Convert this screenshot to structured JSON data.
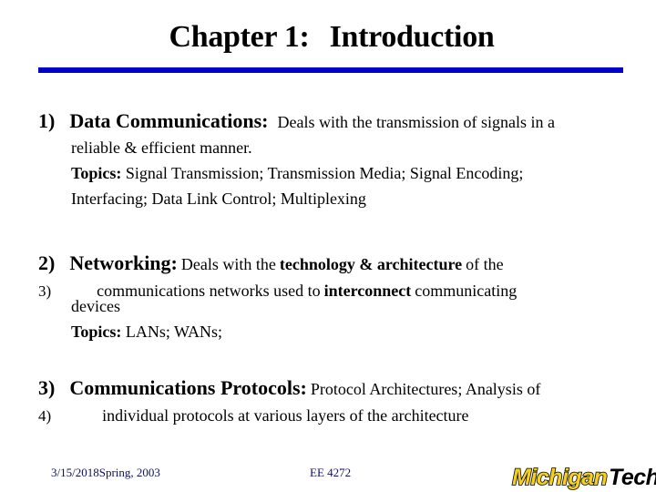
{
  "slide": {
    "title_part1": "Chapter 1:",
    "title_part2": "Introduction",
    "accent_color": "#0000cc"
  },
  "items": [
    {
      "number": "1)",
      "heading": "Data Communications:",
      "text1": "Deals with the transmission of signals in a",
      "text2": "reliable & efficient manner.",
      "topics_label": "Topics:",
      "topics_line1": "Signal Transmission; Transmission Media; Signal Encoding;",
      "topics_line2": "Interfacing; Data Link Control; Multiplexing"
    },
    {
      "number": "2)",
      "heading": "Networking:",
      "text_a": "Deals with the",
      "bold_a": "technology & architecture",
      "text_b": "of the",
      "sub_number": "3)",
      "text_c": "communications networks used to",
      "bold_b": "interconnect",
      "text_d": "communicating",
      "text_e": "devices",
      "topics_label": "Topics:",
      "topics_line1": "LANs; WANs;"
    },
    {
      "number": "3)",
      "heading": "Communications Protocols:",
      "text1": "Protocol Architectures; Analysis of",
      "sub_number": "4)",
      "text2": "individual protocols at various layers of the architecture"
    }
  ],
  "footer": {
    "date_term": "3/15/2018Spring, 2003",
    "course": "EE 4272",
    "logo_word1": "Michigan",
    "logo_word2": "Tech"
  }
}
